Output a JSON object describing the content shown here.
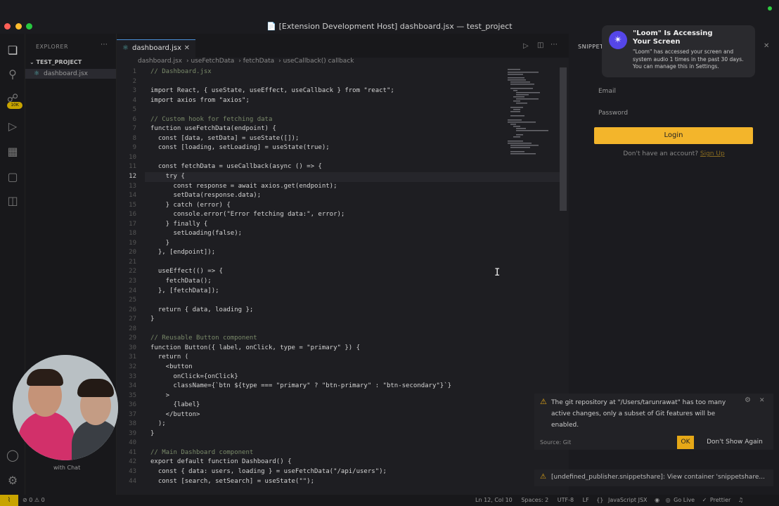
{
  "window": {
    "title": "[Extension Development Host] dashboard.jsx — test_project"
  },
  "explorer": {
    "header": "EXPLORER",
    "project": "TEST_PROJECT",
    "file": "dashboard.jsx"
  },
  "editor": {
    "tab_label": "dashboard.jsx",
    "breadcrumbs": [
      "dashboard.jsx",
      "useFetchData",
      "fetchData",
      "useCallback() callback"
    ],
    "active_line": 12,
    "lines": [
      "// Dashboard.jsx",
      "",
      "import React, { useState, useEffect, useCallback } from \"react\";",
      "import axios from \"axios\";",
      "",
      "// Custom hook for fetching data",
      "function useFetchData(endpoint) {",
      "  const [data, setData] = useState([]);",
      "  const [loading, setLoading] = useState(true);",
      "",
      "  const fetchData = useCallback(async () => {",
      "    try {",
      "      const response = await axios.get(endpoint);",
      "      setData(response.data);",
      "    } catch (error) {",
      "      console.error(\"Error fetching data:\", error);",
      "    } finally {",
      "      setLoading(false);",
      "    }",
      "  }, [endpoint]);",
      "",
      "  useEffect(() => {",
      "    fetchData();",
      "  }, [fetchData]);",
      "",
      "  return { data, loading };",
      "}",
      "",
      "// Reusable Button component",
      "function Button({ label, onClick, type = \"primary\" }) {",
      "  return (",
      "    <button",
      "      onClick={onClick}",
      "      className={`btn ${type === \"primary\" ? \"btn-primary\" : \"btn-secondary\"}`}",
      "    >",
      "      {label}",
      "    </button>",
      "  );",
      "}",
      "",
      "// Main Dashboard component",
      "export default function Dashboard() {",
      "  const { data: users, loading } = useFetchData(\"/api/users\");",
      "  const [search, setSearch] = useState(\"\");"
    ]
  },
  "snippet_panel": {
    "tab": "SNIPPET",
    "email_label": "Email",
    "password_label": "Password",
    "login_label": "Login",
    "no_account": "Don't have an account?",
    "signup": "Sign Up"
  },
  "loom_notification": {
    "title_line1": "\"Loom\" Is Accessing",
    "title_line2": "Your Screen",
    "body": "\"Loom\" has accessed your screen and system audio 1 times in the past 30 days. You can manage this in Settings."
  },
  "git_notification": {
    "message": "The git repository at \"/Users/tarunrawat\" has too many active changes, only a subset of Git features will be enabled.",
    "source": "Source: Git",
    "ok": "OK",
    "dont_show": "Don't Show Again"
  },
  "snippet_notification": {
    "message": "[undefined_publisher.snippetshare]: View container 'snippetshare..."
  },
  "activity_badge": "10K",
  "webcam_caption": "with Chat",
  "statusbar": {
    "errors": "0",
    "warnings": "0",
    "position": "Ln 12, Col 10",
    "spaces": "Spaces: 2",
    "encoding": "UTF-8",
    "eol": "LF",
    "language": "JavaScript JSX",
    "golive": "Go Live",
    "prettier": "Prettier"
  },
  "colors": {
    "accent": "#4a90d9",
    "login_button": "#f3b52b",
    "ok_button": "#e6a817"
  }
}
